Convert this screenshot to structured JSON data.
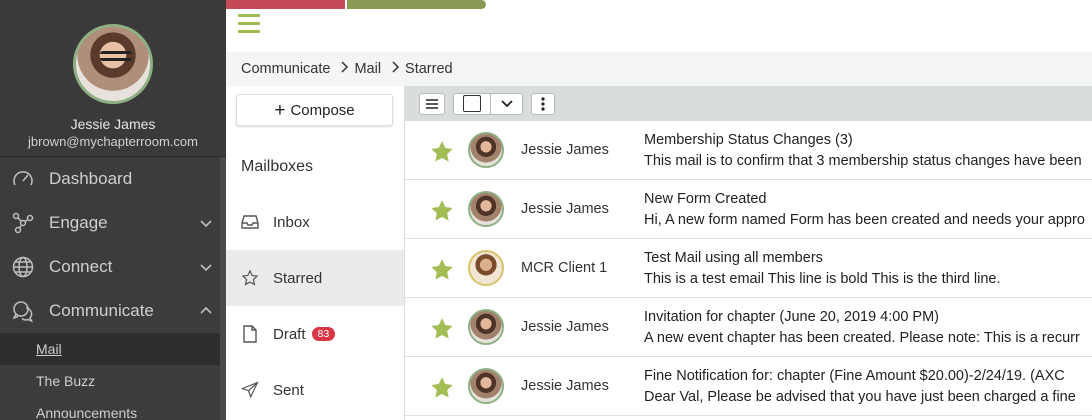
{
  "profile": {
    "name": "Jessie James",
    "email": "jbrown@mychapterroom.com"
  },
  "nav": {
    "items": [
      {
        "label": "Dashboard"
      },
      {
        "label": "Engage"
      },
      {
        "label": "Connect"
      },
      {
        "label": "Communicate"
      }
    ],
    "subitems": [
      {
        "label": "Mail"
      },
      {
        "label": "The Buzz"
      },
      {
        "label": "Announcements"
      }
    ]
  },
  "breadcrumb": [
    "Communicate",
    "Mail",
    "Starred"
  ],
  "compose": {
    "label": "Compose"
  },
  "mailboxes": {
    "title": "Mailboxes",
    "items": [
      {
        "label": "Inbox"
      },
      {
        "label": "Starred"
      },
      {
        "label": "Draft",
        "badge": "83"
      },
      {
        "label": "Sent"
      }
    ]
  },
  "colors": {
    "accent_green": "#9fba4e",
    "star": "#a3bd55",
    "badge_red": "#d93646",
    "progress_red": "#c44a57",
    "progress_green": "#8a9a55"
  },
  "mails": [
    {
      "sender": "Jessie James",
      "subject": "Membership Status Changes (3)",
      "preview": "This mail is to confirm that 3 membership status changes have been"
    },
    {
      "sender": "Jessie James",
      "subject": "New Form Created",
      "preview": "Hi, A new form named Form has been created and needs your appro"
    },
    {
      "sender": "MCR Client 1",
      "subject": "Test Mail using all members",
      "preview": "This is a test email This line is bold This is the third line."
    },
    {
      "sender": "Jessie James",
      "subject": "Invitation for chapter (June 20, 2019 4:00 PM)",
      "preview": "A new event chapter has been created. Please note: This is a recurr"
    },
    {
      "sender": "Jessie James",
      "subject": "Fine Notification for: chapter (Fine Amount $20.00)-2/24/19. (AXC",
      "preview": "Dear Val, Please be advised that you have just been charged a fine"
    }
  ]
}
